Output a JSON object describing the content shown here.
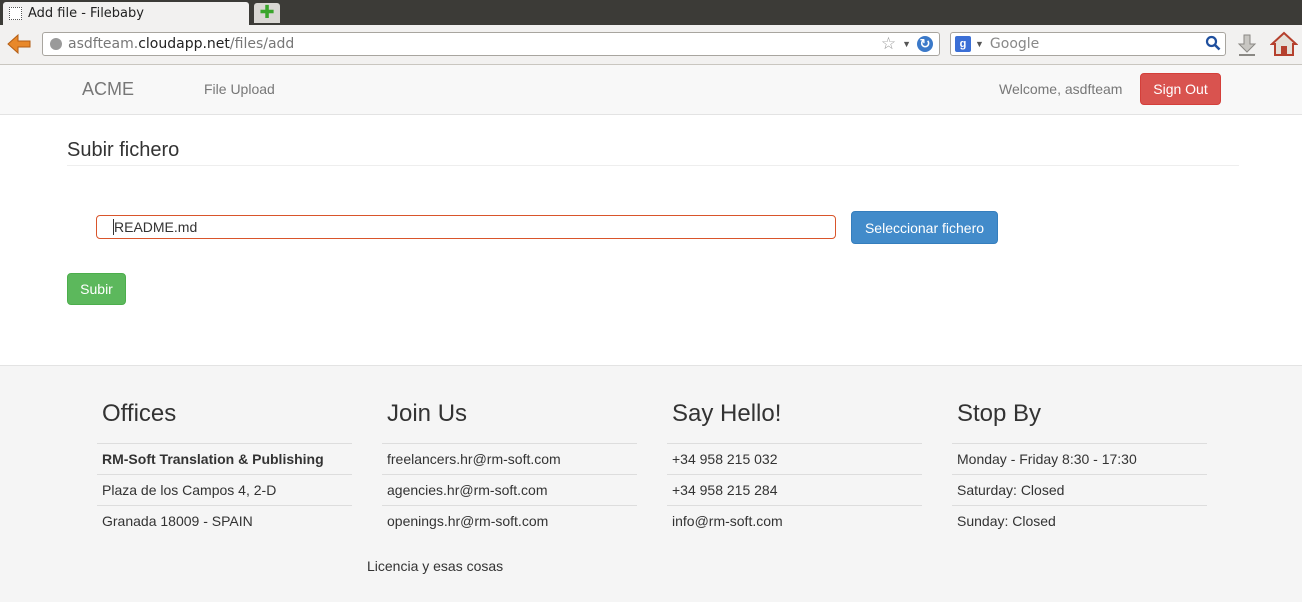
{
  "browser": {
    "tab_title": "Add file - Filebaby",
    "url_host_prefix": "asdfteam.",
    "url_host_main": "cloudapp.net",
    "url_path": "/files/add",
    "search_placeholder": "Google"
  },
  "nav": {
    "brand": "ACME",
    "link_file_upload": "File Upload",
    "welcome": "Welcome, asdfteam",
    "sign_out": "Sign Out"
  },
  "main": {
    "title": "Subir fichero",
    "file_value": "README.md",
    "select_button": "Seleccionar fichero",
    "submit_button": "Subir"
  },
  "footer": {
    "columns": [
      {
        "heading": "Offices",
        "rows": [
          "RM-Soft Translation & Publishing",
          "Plaza de los Campos 4, 2-D",
          "Granada 18009 - SPAIN"
        ]
      },
      {
        "heading": "Join Us",
        "rows": [
          "freelancers.hr@rm-soft.com",
          "agencies.hr@rm-soft.com",
          "openings.hr@rm-soft.com"
        ]
      },
      {
        "heading": "Say Hello!",
        "rows": [
          "+34 958 215 032",
          "+34 958 215 284",
          "info@rm-soft.com"
        ]
      },
      {
        "heading": "Stop By",
        "rows": [
          "Monday - Friday 8:30 - 17:30",
          "Saturday: Closed",
          "Sunday: Closed"
        ]
      }
    ],
    "license": "Licencia y esas cosas"
  },
  "colors": {
    "danger": "#d9534f",
    "primary": "#428bca",
    "success": "#5cb85c",
    "focus_border": "#d9552b"
  }
}
